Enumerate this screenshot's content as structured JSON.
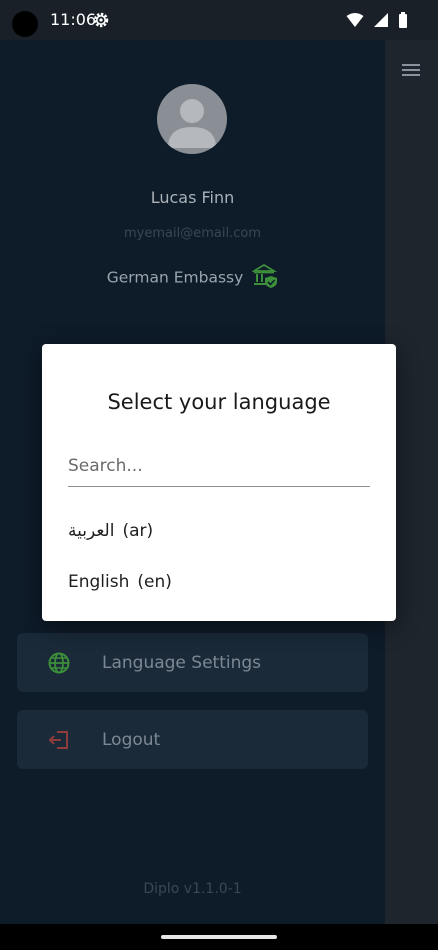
{
  "status_bar": {
    "time": "11:06"
  },
  "profile": {
    "name": "Lucas Finn",
    "email": "myemail@email.com",
    "organization": "German Embassy"
  },
  "menu": {
    "language_settings_label": "Language Settings",
    "logout_label": "Logout"
  },
  "footer": {
    "version": "Diplo v1.1.0-1"
  },
  "dialog": {
    "title": "Select your language",
    "search_placeholder": "Search...",
    "languages": [
      {
        "name": "العربية",
        "code": "(ar)"
      },
      {
        "name": "English",
        "code": "(en)"
      }
    ]
  },
  "colors": {
    "drawer_bg": "#0e1b29",
    "verified_green": "#3d8f3a",
    "logout_red": "#8e3b3b"
  }
}
